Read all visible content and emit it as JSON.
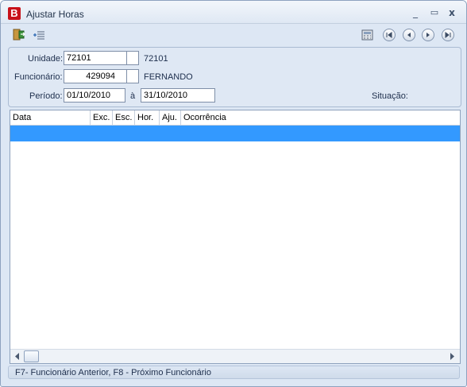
{
  "window": {
    "title": "Ajustar Horas",
    "app_icon_letter": "B",
    "minimize": "_",
    "maximize": "▭",
    "close": "x"
  },
  "toolbar": {
    "icons": [
      "exit-icon",
      "list-add-icon",
      "calculator-icon",
      "first-record-icon",
      "prev-record-icon",
      "next-record-icon",
      "last-record-icon"
    ]
  },
  "form": {
    "unidade_label": "Unidade:",
    "unidade_value": "72101",
    "unidade_name": "72101",
    "funcionario_label": "Funcionário:",
    "funcionario_value": "429094",
    "funcionario_name": "FERNANDO",
    "periodo_label": "Período:",
    "periodo_start": "01/10/2010",
    "periodo_sep": "à",
    "periodo_end": "31/10/2010",
    "situacao_label": "Situação:"
  },
  "grid": {
    "columns": [
      "Data",
      "Exc.",
      "Esc.",
      "Hor.",
      "Aju.",
      "Ocorrência"
    ],
    "selection_color": "#3399ff"
  },
  "status": {
    "text": "F7- Funcionário Anterior,  F8 - Próximo Funcionário"
  }
}
